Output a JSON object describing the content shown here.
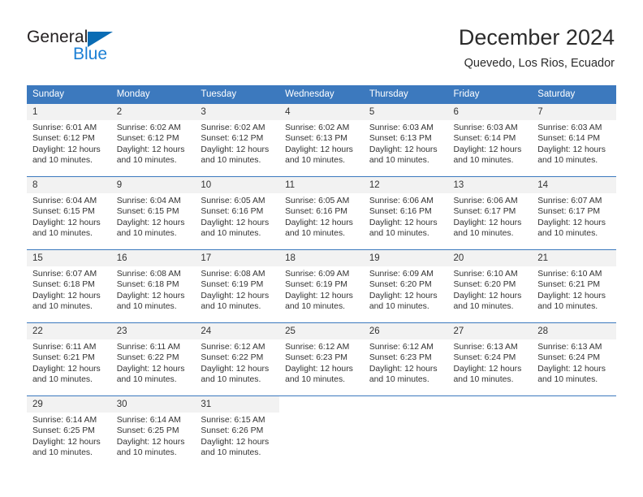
{
  "brand": {
    "name_part1": "General",
    "name_part2": "Blue",
    "accent_color": "#1b7fd4",
    "triangle_color": "#0a6cb4"
  },
  "header": {
    "title": "December 2024",
    "subtitle": "Quevedo, Los Rios, Ecuador"
  },
  "theme": {
    "header_bar_color": "#3c79be",
    "daynum_background": "#f2f2f2",
    "text_color": "#333333"
  },
  "weekday_headers": [
    "Sunday",
    "Monday",
    "Tuesday",
    "Wednesday",
    "Thursday",
    "Friday",
    "Saturday"
  ],
  "weeks": [
    [
      {
        "day": "1",
        "sunrise": "Sunrise: 6:01 AM",
        "sunset": "Sunset: 6:12 PM",
        "daylight_line1": "Daylight: 12 hours",
        "daylight_line2": "and 10 minutes."
      },
      {
        "day": "2",
        "sunrise": "Sunrise: 6:02 AM",
        "sunset": "Sunset: 6:12 PM",
        "daylight_line1": "Daylight: 12 hours",
        "daylight_line2": "and 10 minutes."
      },
      {
        "day": "3",
        "sunrise": "Sunrise: 6:02 AM",
        "sunset": "Sunset: 6:12 PM",
        "daylight_line1": "Daylight: 12 hours",
        "daylight_line2": "and 10 minutes."
      },
      {
        "day": "4",
        "sunrise": "Sunrise: 6:02 AM",
        "sunset": "Sunset: 6:13 PM",
        "daylight_line1": "Daylight: 12 hours",
        "daylight_line2": "and 10 minutes."
      },
      {
        "day": "5",
        "sunrise": "Sunrise: 6:03 AM",
        "sunset": "Sunset: 6:13 PM",
        "daylight_line1": "Daylight: 12 hours",
        "daylight_line2": "and 10 minutes."
      },
      {
        "day": "6",
        "sunrise": "Sunrise: 6:03 AM",
        "sunset": "Sunset: 6:14 PM",
        "daylight_line1": "Daylight: 12 hours",
        "daylight_line2": "and 10 minutes."
      },
      {
        "day": "7",
        "sunrise": "Sunrise: 6:03 AM",
        "sunset": "Sunset: 6:14 PM",
        "daylight_line1": "Daylight: 12 hours",
        "daylight_line2": "and 10 minutes."
      }
    ],
    [
      {
        "day": "8",
        "sunrise": "Sunrise: 6:04 AM",
        "sunset": "Sunset: 6:15 PM",
        "daylight_line1": "Daylight: 12 hours",
        "daylight_line2": "and 10 minutes."
      },
      {
        "day": "9",
        "sunrise": "Sunrise: 6:04 AM",
        "sunset": "Sunset: 6:15 PM",
        "daylight_line1": "Daylight: 12 hours",
        "daylight_line2": "and 10 minutes."
      },
      {
        "day": "10",
        "sunrise": "Sunrise: 6:05 AM",
        "sunset": "Sunset: 6:16 PM",
        "daylight_line1": "Daylight: 12 hours",
        "daylight_line2": "and 10 minutes."
      },
      {
        "day": "11",
        "sunrise": "Sunrise: 6:05 AM",
        "sunset": "Sunset: 6:16 PM",
        "daylight_line1": "Daylight: 12 hours",
        "daylight_line2": "and 10 minutes."
      },
      {
        "day": "12",
        "sunrise": "Sunrise: 6:06 AM",
        "sunset": "Sunset: 6:16 PM",
        "daylight_line1": "Daylight: 12 hours",
        "daylight_line2": "and 10 minutes."
      },
      {
        "day": "13",
        "sunrise": "Sunrise: 6:06 AM",
        "sunset": "Sunset: 6:17 PM",
        "daylight_line1": "Daylight: 12 hours",
        "daylight_line2": "and 10 minutes."
      },
      {
        "day": "14",
        "sunrise": "Sunrise: 6:07 AM",
        "sunset": "Sunset: 6:17 PM",
        "daylight_line1": "Daylight: 12 hours",
        "daylight_line2": "and 10 minutes."
      }
    ],
    [
      {
        "day": "15",
        "sunrise": "Sunrise: 6:07 AM",
        "sunset": "Sunset: 6:18 PM",
        "daylight_line1": "Daylight: 12 hours",
        "daylight_line2": "and 10 minutes."
      },
      {
        "day": "16",
        "sunrise": "Sunrise: 6:08 AM",
        "sunset": "Sunset: 6:18 PM",
        "daylight_line1": "Daylight: 12 hours",
        "daylight_line2": "and 10 minutes."
      },
      {
        "day": "17",
        "sunrise": "Sunrise: 6:08 AM",
        "sunset": "Sunset: 6:19 PM",
        "daylight_line1": "Daylight: 12 hours",
        "daylight_line2": "and 10 minutes."
      },
      {
        "day": "18",
        "sunrise": "Sunrise: 6:09 AM",
        "sunset": "Sunset: 6:19 PM",
        "daylight_line1": "Daylight: 12 hours",
        "daylight_line2": "and 10 minutes."
      },
      {
        "day": "19",
        "sunrise": "Sunrise: 6:09 AM",
        "sunset": "Sunset: 6:20 PM",
        "daylight_line1": "Daylight: 12 hours",
        "daylight_line2": "and 10 minutes."
      },
      {
        "day": "20",
        "sunrise": "Sunrise: 6:10 AM",
        "sunset": "Sunset: 6:20 PM",
        "daylight_line1": "Daylight: 12 hours",
        "daylight_line2": "and 10 minutes."
      },
      {
        "day": "21",
        "sunrise": "Sunrise: 6:10 AM",
        "sunset": "Sunset: 6:21 PM",
        "daylight_line1": "Daylight: 12 hours",
        "daylight_line2": "and 10 minutes."
      }
    ],
    [
      {
        "day": "22",
        "sunrise": "Sunrise: 6:11 AM",
        "sunset": "Sunset: 6:21 PM",
        "daylight_line1": "Daylight: 12 hours",
        "daylight_line2": "and 10 minutes."
      },
      {
        "day": "23",
        "sunrise": "Sunrise: 6:11 AM",
        "sunset": "Sunset: 6:22 PM",
        "daylight_line1": "Daylight: 12 hours",
        "daylight_line2": "and 10 minutes."
      },
      {
        "day": "24",
        "sunrise": "Sunrise: 6:12 AM",
        "sunset": "Sunset: 6:22 PM",
        "daylight_line1": "Daylight: 12 hours",
        "daylight_line2": "and 10 minutes."
      },
      {
        "day": "25",
        "sunrise": "Sunrise: 6:12 AM",
        "sunset": "Sunset: 6:23 PM",
        "daylight_line1": "Daylight: 12 hours",
        "daylight_line2": "and 10 minutes."
      },
      {
        "day": "26",
        "sunrise": "Sunrise: 6:12 AM",
        "sunset": "Sunset: 6:23 PM",
        "daylight_line1": "Daylight: 12 hours",
        "daylight_line2": "and 10 minutes."
      },
      {
        "day": "27",
        "sunrise": "Sunrise: 6:13 AM",
        "sunset": "Sunset: 6:24 PM",
        "daylight_line1": "Daylight: 12 hours",
        "daylight_line2": "and 10 minutes."
      },
      {
        "day": "28",
        "sunrise": "Sunrise: 6:13 AM",
        "sunset": "Sunset: 6:24 PM",
        "daylight_line1": "Daylight: 12 hours",
        "daylight_line2": "and 10 minutes."
      }
    ],
    [
      {
        "day": "29",
        "sunrise": "Sunrise: 6:14 AM",
        "sunset": "Sunset: 6:25 PM",
        "daylight_line1": "Daylight: 12 hours",
        "daylight_line2": "and 10 minutes."
      },
      {
        "day": "30",
        "sunrise": "Sunrise: 6:14 AM",
        "sunset": "Sunset: 6:25 PM",
        "daylight_line1": "Daylight: 12 hours",
        "daylight_line2": "and 10 minutes."
      },
      {
        "day": "31",
        "sunrise": "Sunrise: 6:15 AM",
        "sunset": "Sunset: 6:26 PM",
        "daylight_line1": "Daylight: 12 hours",
        "daylight_line2": "and 10 minutes."
      },
      {
        "day": "",
        "sunrise": "",
        "sunset": "",
        "daylight_line1": "",
        "daylight_line2": ""
      },
      {
        "day": "",
        "sunrise": "",
        "sunset": "",
        "daylight_line1": "",
        "daylight_line2": ""
      },
      {
        "day": "",
        "sunrise": "",
        "sunset": "",
        "daylight_line1": "",
        "daylight_line2": ""
      },
      {
        "day": "",
        "sunrise": "",
        "sunset": "",
        "daylight_line1": "",
        "daylight_line2": ""
      }
    ]
  ]
}
